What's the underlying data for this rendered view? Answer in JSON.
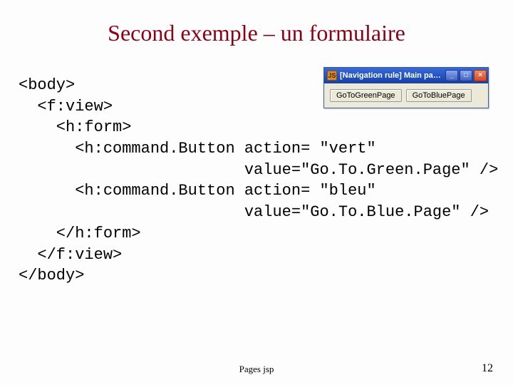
{
  "title": "Second exemple – un formulaire",
  "window": {
    "title": "[Navigation rule] Main page…",
    "icon_label": "JS",
    "buttons": [
      "GoToGreenPage",
      "GoToBluePage"
    ],
    "controls": {
      "minimize": "_",
      "maximize": "□",
      "close": "×"
    }
  },
  "code": {
    "l1": "<body>",
    "l2": "  <f:view>",
    "l3": "    <h:form>",
    "l4": "      <h:command.Button action= \"vert\"",
    "l5": "                        value=\"Go.To.Green.Page\" />",
    "l6": "      <h:command.Button action= \"bleu\"",
    "l7": "                        value=\"Go.To.Blue.Page\" />",
    "l8": "    </h:form>",
    "l9": "  </f:view>",
    "l10": "</body>"
  },
  "footer": {
    "center": "Pages jsp",
    "page_number": "12"
  }
}
